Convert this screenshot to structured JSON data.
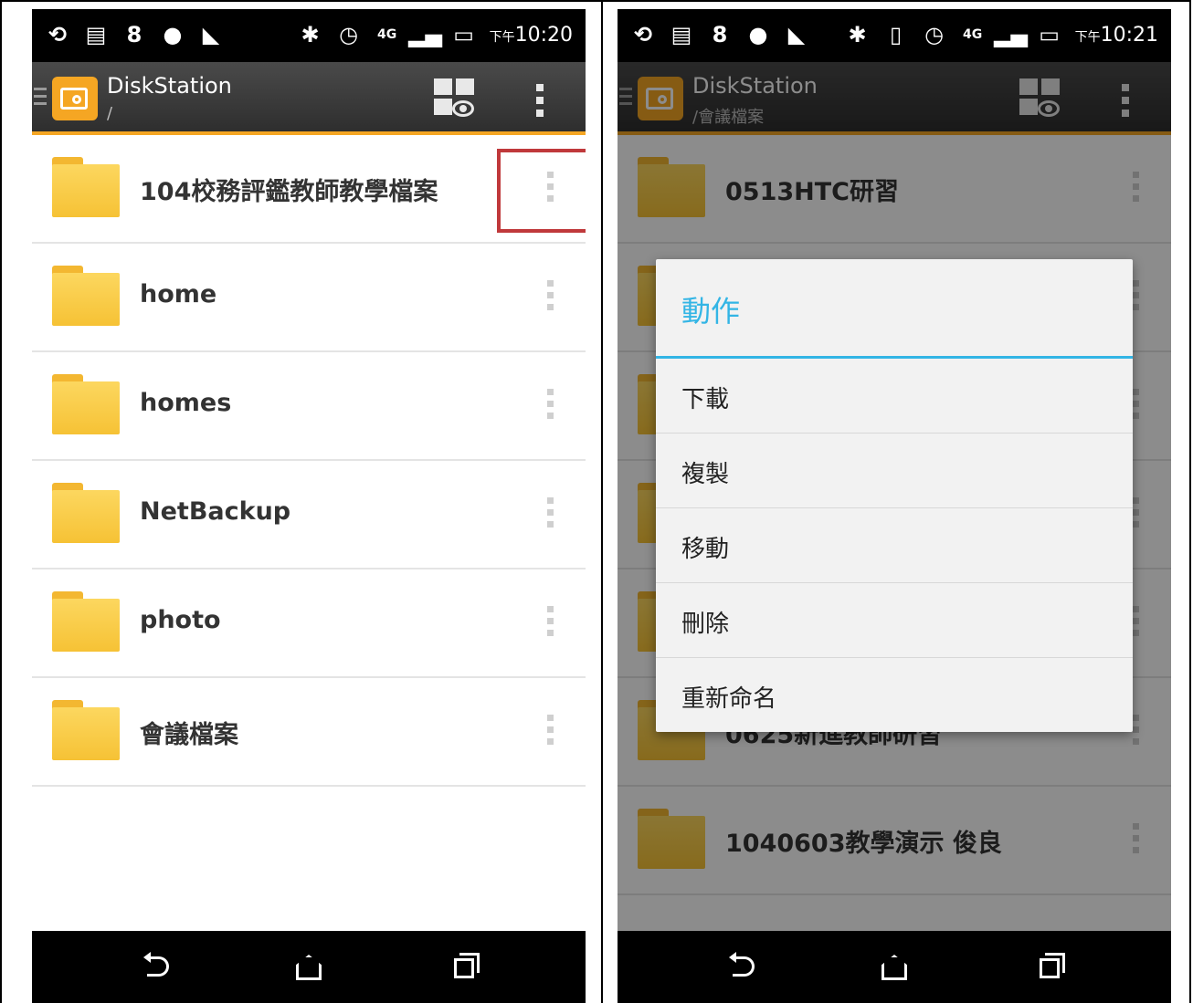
{
  "colors": {
    "accent": "#f5a623",
    "dialog_accent": "#33b5e5",
    "highlight": "#c0393b"
  },
  "left": {
    "status": {
      "time_prefix": "下午",
      "time": "10:20",
      "icons": [
        "sync-icon",
        "notes-icon",
        "google-plus-icon",
        "line-icon",
        "missed-call-icon",
        "bluetooth-icon",
        "alarm-icon",
        "4g-icon",
        "signal-icon",
        "battery-icon"
      ]
    },
    "appbar": {
      "title": "DiskStation",
      "path": "/"
    },
    "folders": [
      {
        "name": "104校務評鑑教師教學檔案"
      },
      {
        "name": "home"
      },
      {
        "name": "homes"
      },
      {
        "name": "NetBackup"
      },
      {
        "name": "photo"
      },
      {
        "name": "會議檔案"
      }
    ]
  },
  "right": {
    "status": {
      "time_prefix": "下午",
      "time": "10:21",
      "icons": [
        "sync-icon",
        "notes-icon",
        "google-plus-icon",
        "line-icon",
        "missed-call-icon",
        "bluetooth-icon",
        "vibrate-icon",
        "alarm-icon",
        "4g-icon",
        "signal-icon",
        "battery-icon"
      ]
    },
    "appbar": {
      "title": "DiskStation",
      "path": "/會議檔案"
    },
    "folders": [
      {
        "name": "0513HTC研習"
      },
      {
        "name": ""
      },
      {
        "name": ""
      },
      {
        "name": ""
      },
      {
        "name": ""
      },
      {
        "name": "0625新進教師研習"
      },
      {
        "name": "1040603教學演示 俊良"
      }
    ],
    "dialog": {
      "title": "動作",
      "items": [
        "下載",
        "複製",
        "移動",
        "刪除",
        "重新命名"
      ]
    }
  }
}
